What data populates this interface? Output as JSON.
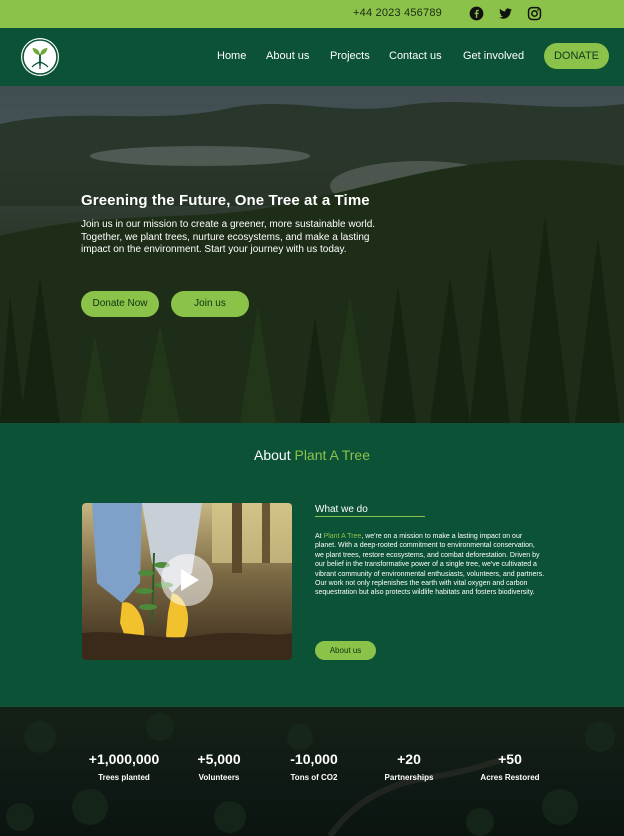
{
  "topbar": {
    "phone": "+44 2023 456789",
    "social": [
      "facebook-icon",
      "twitter-icon",
      "instagram-icon"
    ]
  },
  "nav": {
    "links": [
      "Home",
      "About us",
      "Projects",
      "Contact us",
      "Get involved"
    ],
    "donate_label": "DONATE"
  },
  "hero": {
    "title": "Greening the Future, One Tree at a Time",
    "text": "Join us in our mission to create a greener, more sustainable world. Together, we plant trees, nurture ecosystems, and make a lasting impact on the environment. Start your journey with us today.",
    "donate_now_label": "Donate Now",
    "join_label": "Join us"
  },
  "about": {
    "heading_prefix": "About ",
    "heading_accent": "Plant A Tree",
    "what_title": "What we do",
    "text_prefix": "At ",
    "text_accent": "Plant A Tree",
    "text_body": ", we're on a mission to make a lasting impact on our planet. With a deep-rooted commitment to environmental conservation, we plant trees, restore ecosystems, and combat deforestation. Driven by our belief in the transformative power of a single tree, we've cultivated a vibrant community of environmental enthusiasts, volunteers, and partners.",
    "text_body2": "Our work not only replenishes the earth with vital oxygen and carbon sequestration but also protects wildlife habitats and fosters biodiversity.",
    "button_label": "About us"
  },
  "stats": [
    {
      "value": "+1,000,000",
      "label": "Trees planted"
    },
    {
      "value": "+5,000",
      "label": "Volunteers"
    },
    {
      "value": "-10,000",
      "label": "Tons of CO2"
    },
    {
      "value": "+20",
      "label": "Partnerships"
    },
    {
      "value": "+50",
      "label": "Acres Restored"
    }
  ],
  "colors": {
    "accent": "#8bc34a",
    "dark_green": "#0b5236"
  }
}
